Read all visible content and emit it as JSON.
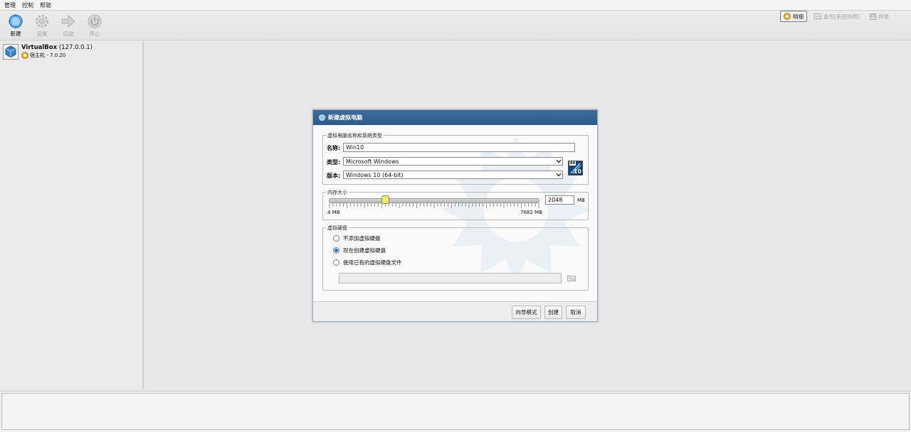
{
  "menu": [
    "管理",
    "控制",
    "帮助"
  ],
  "toolbar": {
    "new_label": "新建",
    "settings_label": "设置",
    "start_label": "启动",
    "stop_label": "停止"
  },
  "right_tools": {
    "details_label": "明细",
    "snapshots_label": "备份[系统快照]",
    "log_label": "终端"
  },
  "vm": {
    "name": "VirtualBox",
    "host_addr": "(127.0.0.1)",
    "subtitle": "宿主机 - 7.0.20"
  },
  "dialog": {
    "title": "新建虚拟电脑",
    "group_name_type": "虚拟电脑名称和系统类型",
    "name_label": "名称:",
    "name_value": "Win10",
    "type_label": "类型:",
    "type_value": "Microsoft Windows",
    "version_label": "版本:",
    "version_value": "Windows 10 (64-bit)",
    "os_badge_top": "64",
    "os_badge_num": "10",
    "memory_group": "内存大小",
    "memory_value": "2048",
    "memory_unit": "MB",
    "memory_min_label": "4 MB",
    "memory_max_label": "7682 MB",
    "memory_fraction": 0.266,
    "disk_group": "虚拟硬盘",
    "disk_options": [
      "不添加虚拟硬盘",
      "现在创建虚拟硬盘",
      "使用已有的虚拟硬盘文件"
    ],
    "disk_selected": 1,
    "guided_button": "向导模式",
    "create_button": "创建",
    "cancel_button": "取消"
  },
  "colors": {
    "title_bar": "#2d5a88",
    "radio_checked": "#1f6fd8",
    "slider_thumb": "#f6ea6b"
  }
}
